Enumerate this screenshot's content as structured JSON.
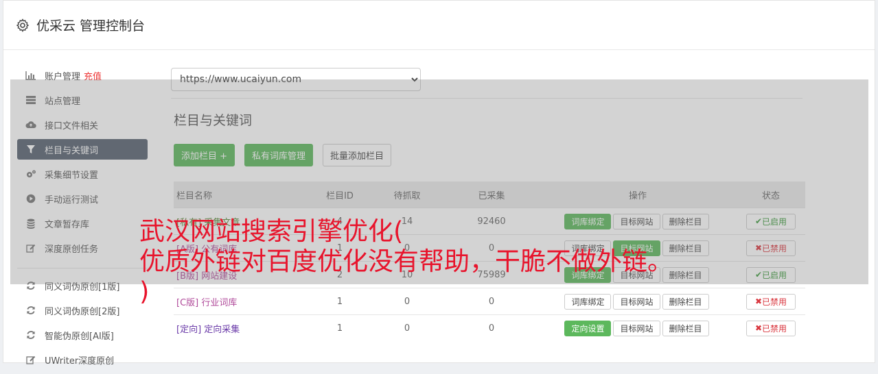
{
  "header": {
    "title": "优采云 管理控制台",
    "icon": "gear-icon"
  },
  "sidebar": {
    "items": [
      {
        "label": "账户管理",
        "extra": "充值",
        "icon": "bar-chart-icon"
      },
      {
        "label": "站点管理",
        "icon": "server-icon"
      },
      {
        "label": "接口文件相关",
        "icon": "cloud-upload-icon"
      },
      {
        "label": "栏目与关键词",
        "icon": "filter-icon",
        "active": true
      },
      {
        "label": "采集细节设置",
        "icon": "cogs-icon"
      },
      {
        "label": "手动运行测试",
        "icon": "play-circle-icon"
      },
      {
        "label": "文章暂存库",
        "icon": "database-icon"
      },
      {
        "label": "深度原创任务",
        "icon": "edit-icon"
      }
    ],
    "items2": [
      {
        "label": "同义词伪原创[1版]",
        "icon": "refresh-icon"
      },
      {
        "label": "同义词伪原创[2版]",
        "icon": "refresh-icon"
      },
      {
        "label": "智能伪原创[AI版]",
        "icon": "refresh-icon"
      },
      {
        "label": "UWriter深度原创",
        "icon": "edit-icon"
      }
    ]
  },
  "main": {
    "site_select": "https://www.ucaiyun.com",
    "section_title": "栏目与关键词",
    "buttons": {
      "add": "添加栏目 +",
      "private_lib": "私有词库管理",
      "batch_add": "批量添加栏目"
    },
    "table": {
      "headers": [
        "栏目名称",
        "栏目ID",
        "待抓取",
        "已采集",
        "操作",
        "状态"
      ],
      "rows": [
        {
          "prefix": "[私有]",
          "name": "采集文章",
          "id": "4",
          "pending": "14",
          "collected": "92460",
          "op1": "词库绑定",
          "op2": "目标网站",
          "op3": "删除栏目",
          "status": "已启用"
        },
        {
          "prefix": "[A版]",
          "name": "公有词库",
          "id": "1",
          "pending": "0",
          "collected": "0",
          "op1": "词库绑定",
          "op2": "目标网站",
          "op3": "删除栏目",
          "status": "已禁用"
        },
        {
          "prefix": "[B版]",
          "name": "网站建设",
          "id": "2",
          "pending": "10",
          "collected": "75989",
          "op1": "词库绑定",
          "op2": "目标网站",
          "op3": "删除栏目",
          "status": "已启用"
        },
        {
          "prefix": "[C版]",
          "name": "行业词库",
          "id": "1",
          "pending": "0",
          "collected": "0",
          "op1": "词库绑定",
          "op2": "目标网站",
          "op3": "删除栏目",
          "status": "已禁用"
        },
        {
          "prefix": "[定向]",
          "name": "定向采集",
          "id": "1",
          "pending": "0",
          "collected": "0",
          "op1": "定向设置",
          "op2": "目标网站",
          "op3": "删除栏目",
          "status": "已禁用"
        }
      ]
    }
  },
  "overlay_text": {
    "line1": "武汉网站搜索引擎优化(",
    "line2": "优质外链对百度优化没有帮助，干脆不做外链。",
    "line3": ")"
  },
  "colors": {
    "green": "#5cb85c",
    "active_bg": "#56606f",
    "red": "#e8142c"
  }
}
